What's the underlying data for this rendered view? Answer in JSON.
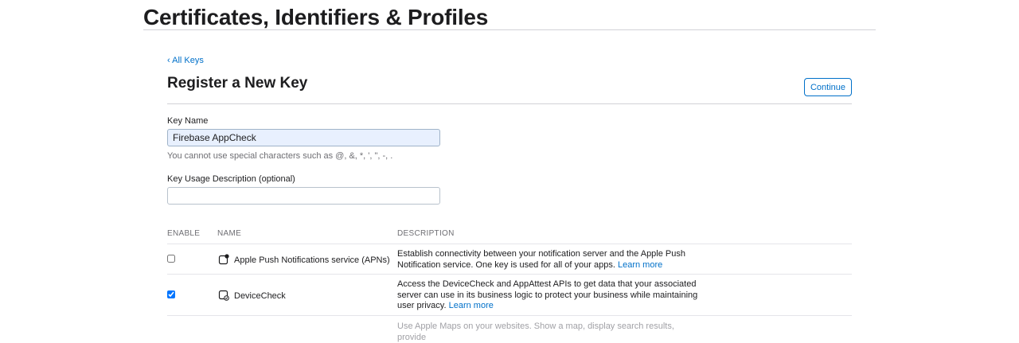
{
  "header": {
    "title": "Certificates, Identifiers & Profiles"
  },
  "nav": {
    "back_label": "‹ All Keys"
  },
  "section": {
    "title": "Register a New Key",
    "continue_label": "Continue"
  },
  "form": {
    "key_name_label": "Key Name",
    "key_name_value": "Firebase AppCheck",
    "key_name_hint": "You cannot use special characters such as @, &, *, ', \", -, .",
    "usage_label": "Key Usage Description (optional)",
    "usage_value": ""
  },
  "table": {
    "headers": {
      "enable": "ENABLE",
      "name": "NAME",
      "description": "DESCRIPTION"
    },
    "rows": [
      {
        "name": "Apple Push Notifications service (APNs)",
        "description": "Establish connectivity between your notification server and the Apple Push Notification service. One key is used for all of your apps.",
        "link": "Learn more",
        "checked": false,
        "icon": "push-notification-icon"
      },
      {
        "name": "DeviceCheck",
        "description": "Access the DeviceCheck and AppAttest APIs to get data that your associated server can use in its business logic to protect your business while maintaining user privacy.",
        "link": "Learn more",
        "checked": true,
        "icon": "device-check-icon"
      },
      {
        "description": "Use Apple Maps on your websites. Show a map, display search results, provide"
      }
    ]
  },
  "colors": {
    "accent": "#0070c9",
    "text": "#1d1d1f",
    "muted": "#6e6e73",
    "rule": "#d2d2d7",
    "autofill": "#e8f0fe"
  }
}
